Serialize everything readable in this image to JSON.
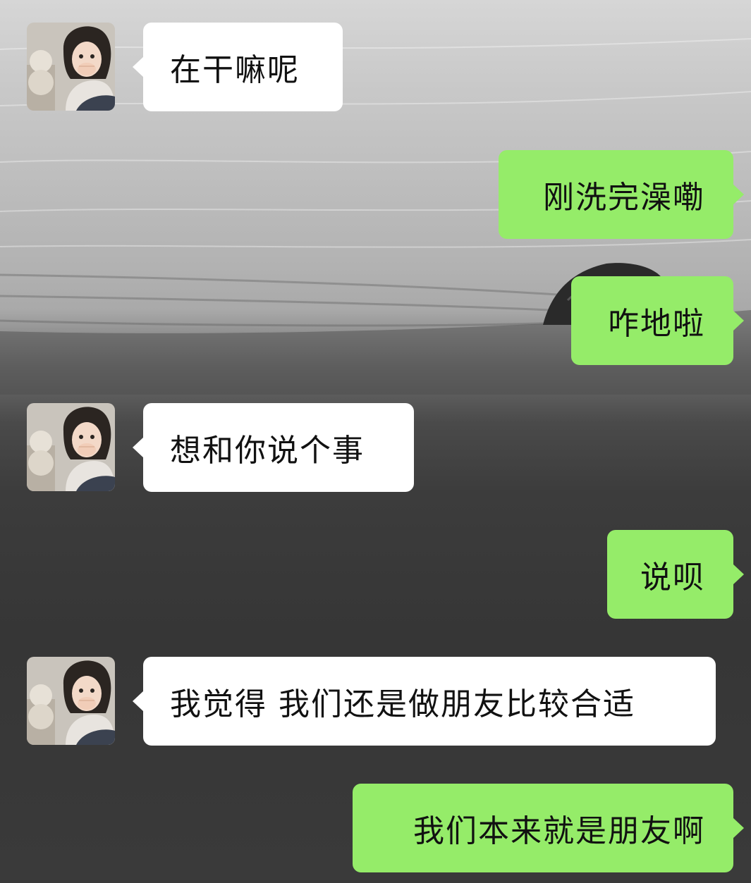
{
  "chat": {
    "contact_avatar": "girl-avatar-icon",
    "messages": [
      {
        "side": "received",
        "text": "在干嘛呢"
      },
      {
        "side": "sent",
        "text": "刚洗完澡嘞"
      },
      {
        "side": "sent",
        "text": "咋地啦"
      },
      {
        "side": "received",
        "text": "想和你说个事"
      },
      {
        "side": "sent",
        "text": "说呗"
      },
      {
        "side": "received",
        "text": "我觉得 我们还是做朋友比较合适"
      },
      {
        "side": "sent",
        "text": "我们本来就是朋友啊"
      }
    ],
    "colors": {
      "sent_bubble": "#95ec69",
      "received_bubble": "#ffffff",
      "text": "#111111"
    }
  }
}
